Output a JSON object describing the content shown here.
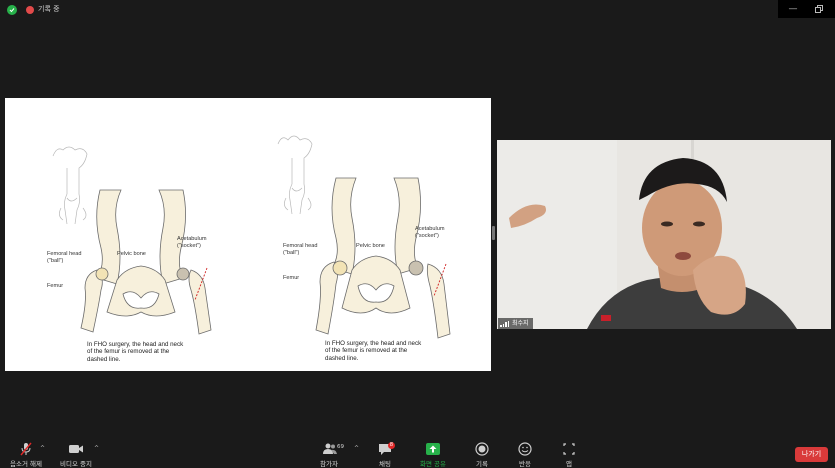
{
  "topbar": {
    "recording_label": "기록 중",
    "window_minimize": "—"
  },
  "slide": {
    "left": {
      "labels": {
        "femoral_head": "Femoral head",
        "ball": "(\"ball\")",
        "pelvic_bone": "Pelvic bone",
        "acetabulum": "Acetabulum",
        "socket": "(\"socket\")",
        "femur": "Femur"
      },
      "caption": [
        "In FHO surgery, the head and neck",
        "of the femur is removed at the",
        "dashed line."
      ]
    },
    "right": {
      "labels": {
        "femoral_head": "Femoral head",
        "ball": "(\"ball\")",
        "pelvic_bone": "Pelvic bone",
        "acetabulum": "Acetabulum",
        "socket": "(\"socket\")",
        "femur": "Femur"
      },
      "caption": [
        "In FHO surgery, the head and neck",
        "of the femur is removed at the",
        "dashed line."
      ]
    }
  },
  "video": {
    "participant_name": "최수지"
  },
  "toolbar": {
    "mute": "음소거 해제",
    "video": "비디오 중지",
    "participants": "참가자",
    "participants_count": "69",
    "chat": "채팅",
    "chat_badge": "8",
    "share": "화면 공유",
    "record": "기록",
    "reactions": "반응",
    "apps": "앱",
    "leave": "나가기"
  },
  "colors": {
    "background": "#1a1a1a",
    "share_green": "#27b14a",
    "leave_red": "#d93a3a",
    "badge_red": "#e02828"
  }
}
